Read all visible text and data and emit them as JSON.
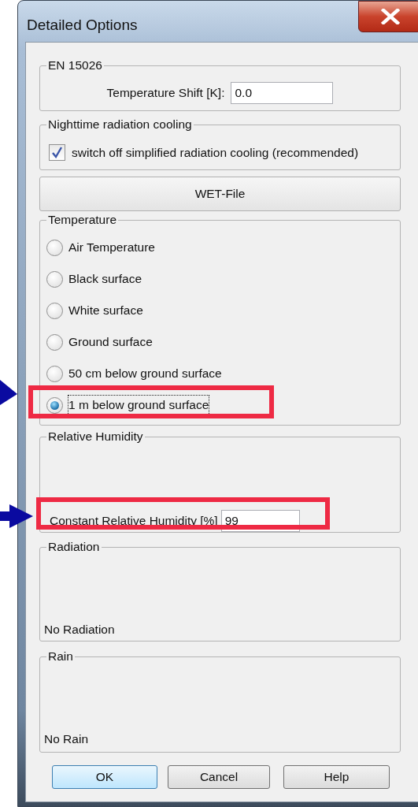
{
  "window": {
    "title": "Detailed Options"
  },
  "en15026": {
    "legend": "EN 15026",
    "label": "Temperature Shift [K]:",
    "value": "0.0"
  },
  "nighttime": {
    "legend": "Nighttime radiation cooling",
    "label": "switch off simplified radiation cooling (recommended)",
    "checked": true
  },
  "wet_file_button": "WET-File",
  "temperature": {
    "legend": "Temperature",
    "options": [
      {
        "label": "Air Temperature",
        "selected": false,
        "highlighted": false
      },
      {
        "label": "Black surface",
        "selected": false,
        "highlighted": false
      },
      {
        "label": "White surface",
        "selected": false,
        "highlighted": false
      },
      {
        "label": "Ground surface",
        "selected": false,
        "highlighted": false
      },
      {
        "label": "50 cm below ground surface",
        "selected": false,
        "highlighted": false
      },
      {
        "label": "1 m below ground surface",
        "selected": true,
        "highlighted": true
      }
    ]
  },
  "relative_humidity": {
    "legend": "Relative Humidity",
    "label": "Constant Relative Humidity [%]",
    "value": "99",
    "highlighted": true
  },
  "radiation": {
    "legend": "Radiation",
    "text": "No Radiation"
  },
  "rain": {
    "legend": "Rain",
    "text": "No Rain"
  },
  "buttons": [
    {
      "label": "OK",
      "default": true
    },
    {
      "label": "Cancel",
      "default": false
    },
    {
      "label": "Help",
      "default": false
    }
  ]
}
